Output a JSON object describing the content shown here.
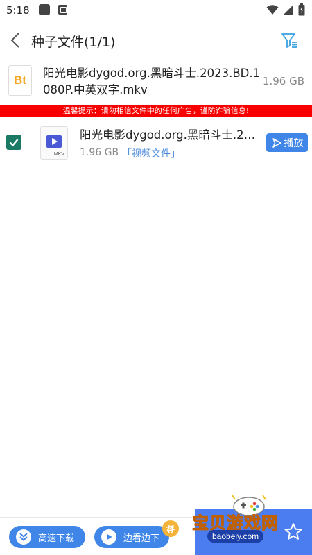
{
  "status_bar": {
    "time": "5:18"
  },
  "header": {
    "title": "种子文件(1/1)"
  },
  "torrent": {
    "icon_text": "Bt",
    "name": "阳光电影dygod.org.黑暗斗士.2023.BD.1080P.中英双字.mkv",
    "size": "1.96 GB"
  },
  "warning": {
    "text": "温馨提示：请勿相信文件中的任何广告，谨防诈骗信息!"
  },
  "file": {
    "name": "阳光电影dygod.org.黑暗斗士.20...",
    "size": "1.96 GB",
    "type": "「视频文件」",
    "icon_label": "MKV",
    "checked": true,
    "play_label": "播放"
  },
  "bottom": {
    "speed_download_label": "高速下载",
    "stream_label": "边看边下",
    "save_badge": "存"
  },
  "watermark": {
    "title": "宝贝游戏网",
    "url": "baobeiy.com"
  },
  "colors": {
    "accent": "#3f86e8",
    "warning": "#f80000",
    "checkbox": "#1b7a63",
    "bt_orange": "#f6a623",
    "file_type_blue": "#4a8ad9"
  },
  "icons": {
    "back": "chevron-left-icon",
    "filter": "filter-icon",
    "play": "play-icon",
    "speed": "double-chevron-down-icon",
    "stream": "play-circle-icon"
  }
}
